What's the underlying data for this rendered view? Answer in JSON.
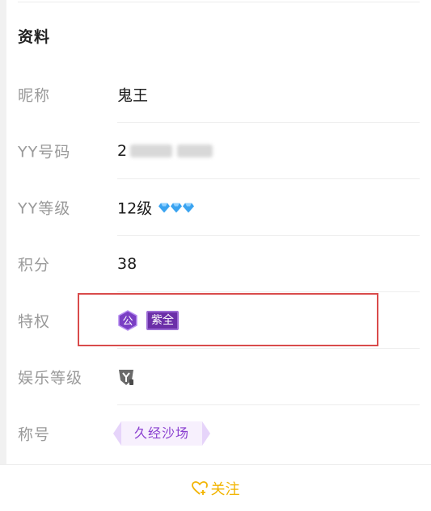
{
  "section": {
    "title": "资料"
  },
  "rows": {
    "nickname": {
      "label": "昵称",
      "value": "鬼王"
    },
    "yy_number": {
      "label": "YY号码",
      "value": "2"
    },
    "yy_level": {
      "label": "YY等级",
      "value": "12级",
      "icon": "diamond-icon"
    },
    "points": {
      "label": "积分",
      "value": "38"
    },
    "privilege": {
      "label": "特权",
      "badge_gong": "公",
      "badge_zi": "紫全"
    },
    "ent_level": {
      "label": "娱乐等级",
      "icon": "y-shield-icon"
    },
    "title": {
      "label": "称号",
      "value": "久经沙场"
    }
  },
  "footer": {
    "follow_label": "关注",
    "icon": "heart-plus-icon"
  },
  "colors": {
    "accent": "#f2b400",
    "highlight": "#d94b4b",
    "purple": "#6b2fa8",
    "diamond": "#3aa3f0"
  }
}
